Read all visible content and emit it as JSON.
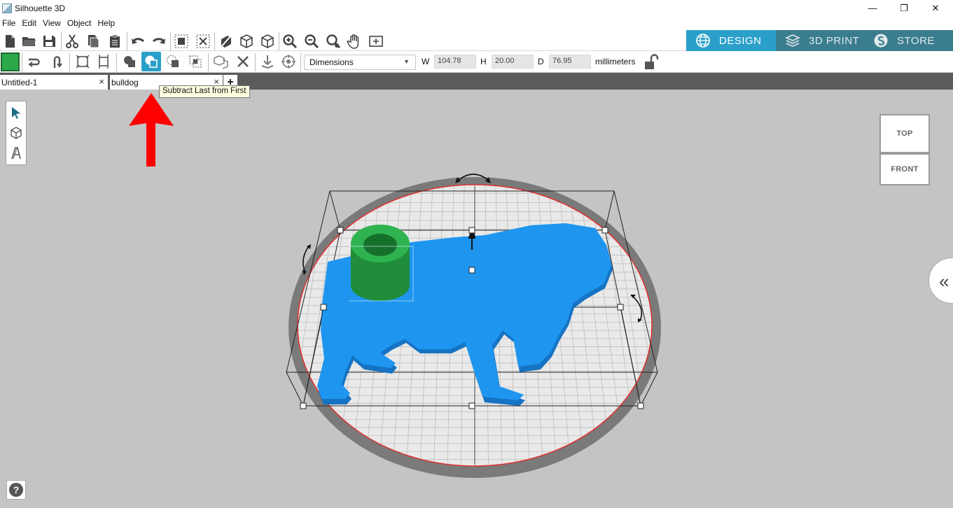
{
  "window": {
    "title": "Silhouette 3D",
    "minimize_glyph": "—",
    "restore_glyph": "❐",
    "close_glyph": "✕"
  },
  "menu": [
    "File",
    "Edit",
    "View",
    "Object",
    "Help"
  ],
  "toolbar1_icons": [
    "new-file-icon",
    "open-folder-icon",
    "save-icon",
    "cut-icon",
    "copy-icon",
    "paste-icon",
    "undo-icon",
    "redo-icon",
    "group-icon",
    "ungroup-icon",
    "rotate-view-icon",
    "cube-icon",
    "cube-alt-icon",
    "zoom-in-icon",
    "zoom-out-icon",
    "zoom-fit-icon",
    "pan-hand-icon",
    "fit-page-icon"
  ],
  "mode_tabs": {
    "design": "DESIGN",
    "print": "3D PRINT",
    "store": "STORE"
  },
  "dimensions": {
    "mode": "Dimensions",
    "w_label": "W",
    "w_value": "104.78",
    "h_label": "H",
    "h_value": "20.00",
    "d_label": "D",
    "d_value": "76.95",
    "units": "millimeters"
  },
  "doc_tabs": [
    {
      "label": "Untitled-1",
      "close": "×"
    },
    {
      "label": "bulldog",
      "close": "×"
    }
  ],
  "new_tab_label": "+",
  "tooltip": "Subtract Last from First",
  "view_cube": {
    "top": "TOP",
    "front": "FRONT"
  },
  "help_label": "?",
  "panel_toggle_label": "«",
  "colors": {
    "accent": "#2a9fc9",
    "tab_inactive": "#3a7d8e",
    "model_blue": "#1e96f0",
    "model_green": "#27a045",
    "annotation_red": "#ff0000"
  }
}
